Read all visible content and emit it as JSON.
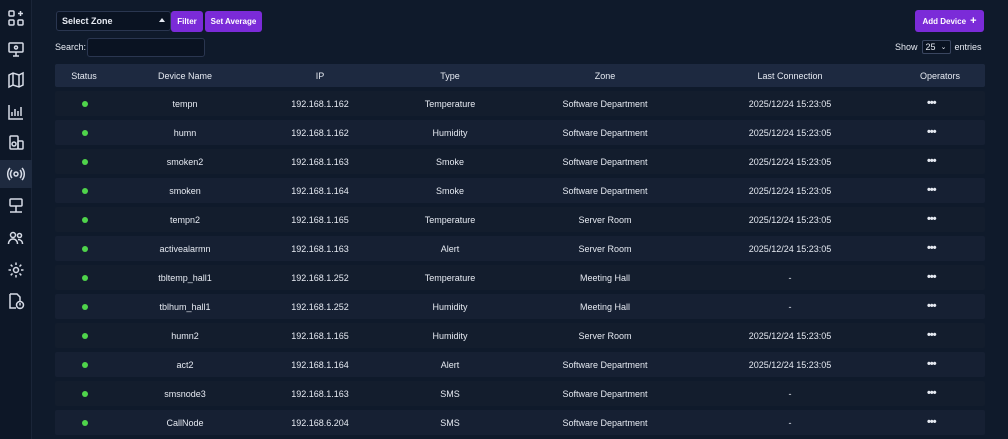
{
  "sidebar": {
    "items": [
      {
        "icon": "apps-add-icon"
      },
      {
        "icon": "monitor-icon"
      },
      {
        "icon": "map-icon"
      },
      {
        "icon": "chart-icon"
      },
      {
        "icon": "devices-icon"
      },
      {
        "icon": "sensor-icon"
      },
      {
        "icon": "network-icon"
      },
      {
        "icon": "users-icon"
      },
      {
        "icon": "settings-icon"
      },
      {
        "icon": "report-icon"
      }
    ]
  },
  "toolbar": {
    "zone_select": "Select Zone",
    "filter_label": "Filter",
    "average_label": "Set Average",
    "add_label": "Add Device",
    "add_icon": "+"
  },
  "search": {
    "label": "Search:",
    "value": ""
  },
  "entries": {
    "show_label": "Show",
    "value": "25",
    "suffix": "entries"
  },
  "table": {
    "headers": [
      "Status",
      "Device Name",
      "IP",
      "Type",
      "Zone",
      "Last Connection",
      "Operators"
    ],
    "rows": [
      {
        "name": "tempn",
        "ip": "192.168.1.162",
        "type": "Temperature",
        "zone": "Software Department",
        "last": "2025/12/24 15:23:05"
      },
      {
        "name": "humn",
        "ip": "192.168.1.162",
        "type": "Humidity",
        "zone": "Software Department",
        "last": "2025/12/24 15:23:05"
      },
      {
        "name": "smoken2",
        "ip": "192.168.1.163",
        "type": "Smoke",
        "zone": "Software Department",
        "last": "2025/12/24 15:23:05"
      },
      {
        "name": "smoken",
        "ip": "192.168.1.164",
        "type": "Smoke",
        "zone": "Software Department",
        "last": "2025/12/24 15:23:05"
      },
      {
        "name": "tempn2",
        "ip": "192.168.1.165",
        "type": "Temperature",
        "zone": "Server Room",
        "last": "2025/12/24 15:23:05"
      },
      {
        "name": "activealarmn",
        "ip": "192.168.1.163",
        "type": "Alert",
        "zone": "Server Room",
        "last": "2025/12/24 15:23:05"
      },
      {
        "name": "tbltemp_hall1",
        "ip": "192.168.1.252",
        "type": "Temperature",
        "zone": "Meeting Hall",
        "last": "-"
      },
      {
        "name": "tblhum_hall1",
        "ip": "192.168.1.252",
        "type": "Humidity",
        "zone": "Meeting Hall",
        "last": "-"
      },
      {
        "name": "humn2",
        "ip": "192.168.1.165",
        "type": "Humidity",
        "zone": "Server Room",
        "last": "2025/12/24 15:23:05"
      },
      {
        "name": "act2",
        "ip": "192.168.1.164",
        "type": "Alert",
        "zone": "Software Department",
        "last": "2025/12/24 15:23:05"
      },
      {
        "name": "smsnode3",
        "ip": "192.168.1.163",
        "type": "SMS",
        "zone": "Software Department",
        "last": "-"
      },
      {
        "name": "CallNode",
        "ip": "192.168.6.204",
        "type": "SMS",
        "zone": "Software Department",
        "last": "-"
      }
    ],
    "operators_glyph": "•••",
    "status_color": "#4fd44b"
  },
  "colors": {
    "accent": "#7b2bd8",
    "background": "#0f1a2b",
    "row": "#131d2d"
  }
}
